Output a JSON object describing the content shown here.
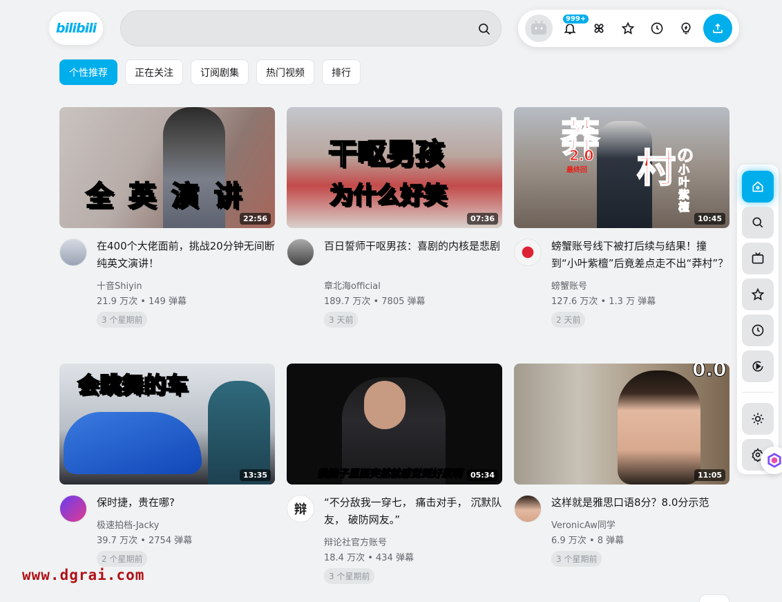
{
  "header": {
    "logo_text": "bilibili",
    "search_placeholder": "",
    "notification_badge": "999+",
    "accent": "#00aeec"
  },
  "tabs": [
    {
      "label": "个性推荐",
      "active": true
    },
    {
      "label": "正在关注",
      "active": false
    },
    {
      "label": "订阅剧集",
      "active": false
    },
    {
      "label": "热门视频",
      "active": false
    },
    {
      "label": "排行",
      "active": false
    }
  ],
  "videos": [
    {
      "thumb_text": "全 英 演 讲",
      "duration": "22:56",
      "title": "在400个大佬面前，挑战20分钟无间断纯英文演讲！",
      "uploader": "十音Shiyin",
      "stats": "21.9 万次 • 149 弹幕",
      "time": "3 个星期前"
    },
    {
      "thumb_text": "干呕男孩",
      "thumb_text2": "为什么好笑",
      "duration": "07:36",
      "title": "百日誓师干呕男孩：喜剧的内核是悲剧",
      "uploader": "章北海official",
      "stats": "189.7 万次 • 7805 弹幕",
      "time": "3 天前"
    },
    {
      "thumb_text": "莽",
      "thumb_text2": "村",
      "thumb_text3": "2.0",
      "thumb_text4": "最终回",
      "thumb_text5": "の",
      "thumb_text6": "小叶紫檀",
      "duration": "10:45",
      "title": "螃蟹账号线下被打后续与结果！撞到“小叶紫檀”后竟差点走不出“莽村”？",
      "uploader": "螃蟹账号",
      "stats": "127.6 万次 • 1.3 万 弹幕",
      "time": "2 天前"
    },
    {
      "thumb_text": "会跳舞的车",
      "duration": "13:35",
      "title": "保时捷，贵在哪?",
      "uploader": "极速拍档-Jacky",
      "stats": "39.7 万次 • 2754 弹幕",
      "time": "2 个星期前"
    },
    {
      "thumb_text": "我脑子里面突然就感觉到好累啊",
      "duration": "05:34",
      "title": "“不分敌我一穿七， 痛击对手， 沉默队友， 破防网友。”",
      "uploader": "辩论社官方账号",
      "stats": "18.4 万次 • 434 弹幕",
      "time": "3 个星期前",
      "avatar_text": "辩"
    },
    {
      "thumb_text": "0.0",
      "duration": "11:05",
      "title": "这样就是雅思口语8分？8.0分示范",
      "uploader": "VeronicAw同学",
      "stats": "6.9 万次 • 8 弹幕",
      "time": "3 个星期前"
    }
  ],
  "watermark": "www.dgrai.com"
}
